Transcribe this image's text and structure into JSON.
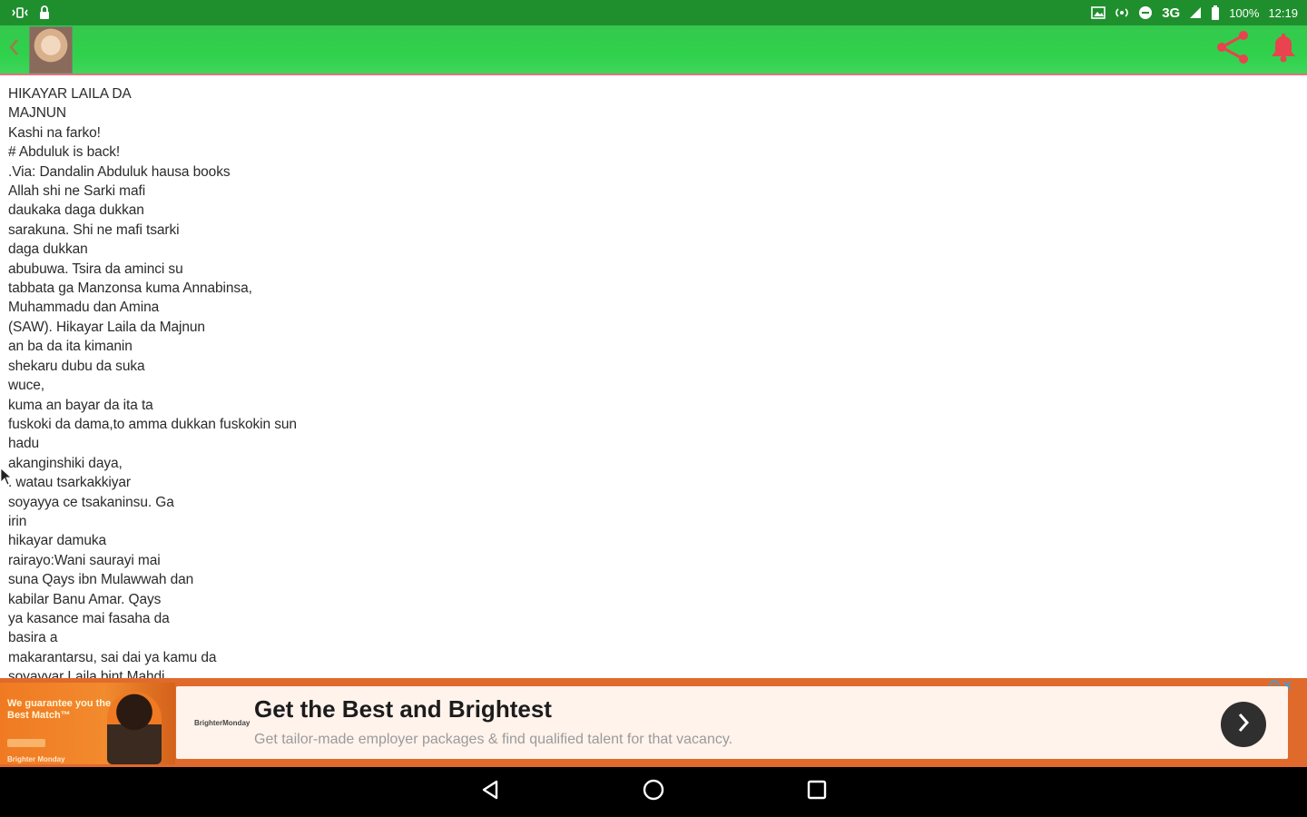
{
  "status_bar": {
    "network": "3G",
    "battery": "100%",
    "time": "12:19"
  },
  "story": {
    "lines": [
      "HIKAYAR LAILA DA",
      "MAJNUN",
      "Kashi na farko!",
      "# Abduluk is back!",
      ".Via: Dandalin Abduluk hausa books",
      "Allah shi ne Sarki mafi",
      "daukaka daga dukkan",
      "sarakuna. Shi ne mafi tsarki",
      "daga dukkan",
      "abubuwa. Tsira da aminci su",
      "tabbata ga Manzonsa kuma Annabinsa,",
      "Muhammadu dan Amina",
      "(SAW). Hikayar Laila da Majnun",
      "an ba da ita kimanin",
      "shekaru dubu da suka",
      "wuce,",
      "kuma an bayar da ita ta",
      "fuskoki da dama,to amma dukkan fuskokin sun",
      "hadu",
      "akanginshiki daya,",
      ". watau tsarkakkiyar",
      "soyayya ce tsakaninsu. Ga",
      "irin",
      "hikayar damuka",
      "rairayo:Wani saurayi mai",
      "suna Qays ibn Mulawwah dan",
      "kabilar Banu Amar. Qays",
      "ya kasance mai fasaha da",
      "basira a",
      "makarantarsu, sai dai ya kamu da",
      "soyayyar Laila bint Mahdi"
    ]
  },
  "ad": {
    "thumb_text": "We guarantee you the Best Match™",
    "thumb_brand": "Brighter Monday",
    "brand": "BrighterMonday",
    "title": "Get the Best and Brightest",
    "description": "Get tailor-made employer packages & find qualified talent for that vacancy."
  },
  "colors": {
    "status_bar": "#1f8f2e",
    "app_bar": "#2fd14c",
    "accent_red": "#e8434e",
    "ad_orange": "#e06a2c"
  },
  "icons": {
    "back": "chevron-left-icon",
    "share": "share-icon",
    "notification": "bell-icon"
  }
}
